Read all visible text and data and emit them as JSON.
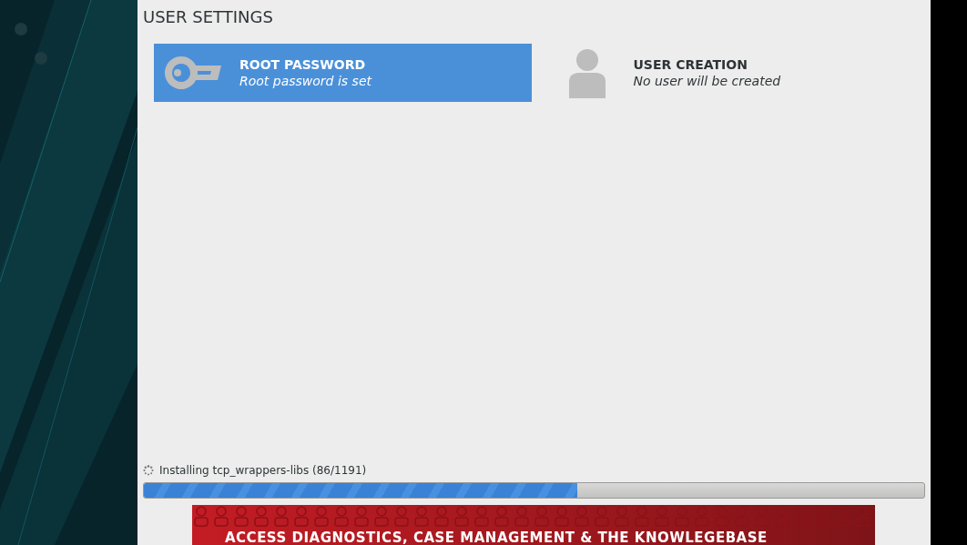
{
  "section_title": "USER SETTINGS",
  "spokes": [
    {
      "kind": "key",
      "title": "ROOT PASSWORD",
      "status": "Root password is set",
      "selected": true
    },
    {
      "kind": "user",
      "title": "USER CREATION",
      "status": "No user will be created",
      "selected": false
    }
  ],
  "progress": {
    "label": "Installing tcp_wrappers-libs (86/1191)",
    "level": 0.555
  },
  "banner": {
    "text": "ACCESS DIAGNOSTICS, CASE MANAGEMENT & THE KNOWLEGEBASE"
  }
}
